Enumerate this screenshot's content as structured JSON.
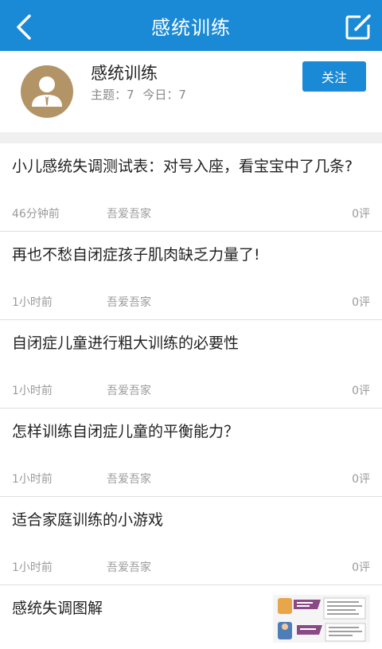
{
  "topbar": {
    "title": "感统训练",
    "back_icon": "chevron-left-icon",
    "compose_icon": "edit-icon",
    "color": "#1a8ad6"
  },
  "forum": {
    "name": "感统训练",
    "topics_label": "主题：7",
    "today_label": "今日：7",
    "follow_label": "关注"
  },
  "posts": [
    {
      "title": "小儿感统失调测试表：对号入座，看宝宝中了几条?",
      "time": "46分钟前",
      "author": "吾爱吾家",
      "comments": "0评"
    },
    {
      "title": "再也不愁自闭症孩子肌肉缺乏力量了!",
      "time": "1小时前",
      "author": "吾爱吾家",
      "comments": "0评"
    },
    {
      "title": "自闭症儿童进行粗大训练的必要性",
      "time": "1小时前",
      "author": "吾爱吾家",
      "comments": "0评"
    },
    {
      "title": "怎样训练自闭症儿童的平衡能力？",
      "time": "1小时前",
      "author": "吾爱吾家",
      "comments": "0评"
    },
    {
      "title": "适合家庭训练的小游戏",
      "time": "1小时前",
      "author": "吾爱吾家",
      "comments": "0评"
    },
    {
      "title": "感统失调图解"
    }
  ]
}
